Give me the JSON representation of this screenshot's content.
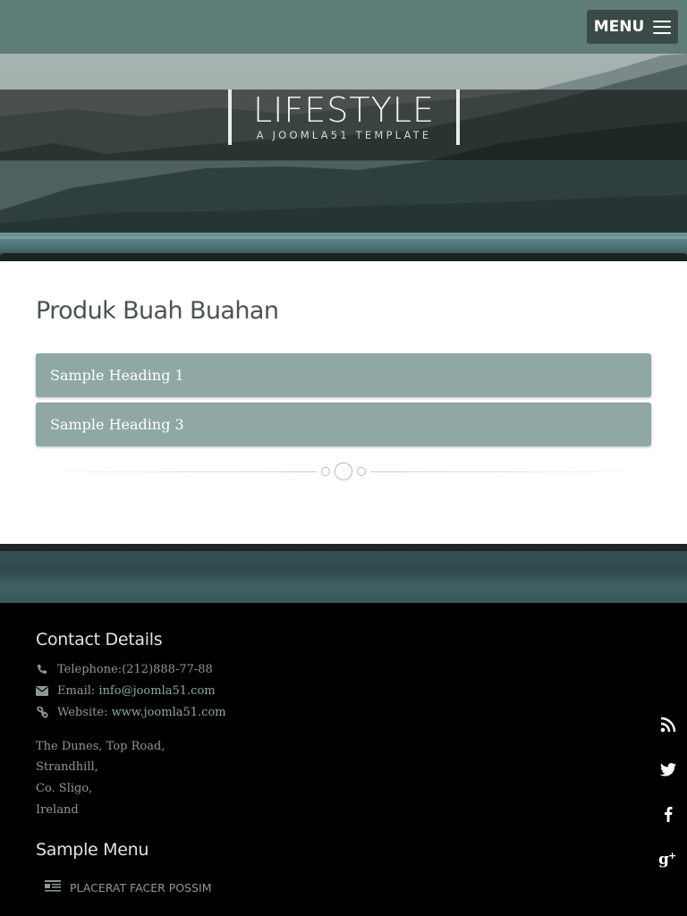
{
  "topbar": {
    "menu_label": "MENU",
    "colors": {
      "bar": "#5f7d78",
      "button": "#3a4a47"
    }
  },
  "hero": {
    "title": "LIFESTYLE",
    "subtitle": "A JOOMLA51 TEMPLATE"
  },
  "main": {
    "page_title": "Produk Buah Buahan",
    "accordion": [
      {
        "label": "Sample Heading 1"
      },
      {
        "label": "Sample Heading 3"
      }
    ],
    "accent_color": "#8fa8a3"
  },
  "footer": {
    "contact_heading": "Contact Details",
    "contacts": [
      {
        "icon": "phone-icon",
        "label": "Telephone:",
        "value": "(212)888-77-88"
      },
      {
        "icon": "envelope-icon",
        "label": "Email:",
        "value": "info@joomla51.com"
      },
      {
        "icon": "link-icon",
        "label": "Website:",
        "value": "www.joomla51.com"
      }
    ],
    "address": [
      "The Dunes, Top Road,",
      "Strandhill,",
      "Co. Sligo,",
      "Ireland"
    ],
    "menu_heading": "Sample Menu",
    "menu_items": [
      {
        "icon": "article-list-icon",
        "label": "PLACERAT FACER POSSIM"
      }
    ],
    "social_icons": [
      "rss-icon",
      "twitter-icon",
      "facebook-icon",
      "google-plus-icon"
    ]
  }
}
